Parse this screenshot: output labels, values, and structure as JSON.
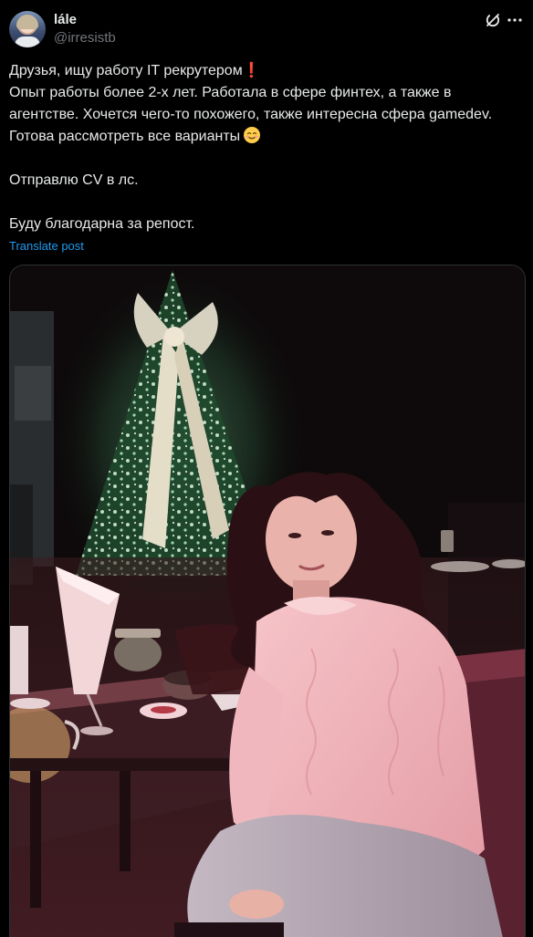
{
  "author": {
    "display_name": "lále",
    "handle": "@irresistb"
  },
  "tweet": {
    "line1": "Друзья, ищу работу IT рекрутером",
    "line1_mark": "❗",
    "line2": "Опыт работы более 2-х лет. Работала в сфере финтех, а также в",
    "line3": "агентстве. Хочется чего-то похожего, также интересна сфера gamedev.",
    "line4": "Готова рассмотреть все варианты",
    "line5": "Отправлю CV в лс.",
    "line6": "Буду благодарна за репост."
  },
  "translate_label": "Translate post",
  "icons": {
    "action": "grok-icon",
    "more": "more-icon",
    "emoji": "smiling-face-emoji"
  },
  "colors": {
    "background": "#000000",
    "text": "#e7e9ea",
    "secondary": "#71767b",
    "link": "#1d9bf0",
    "border": "#2f3336"
  }
}
